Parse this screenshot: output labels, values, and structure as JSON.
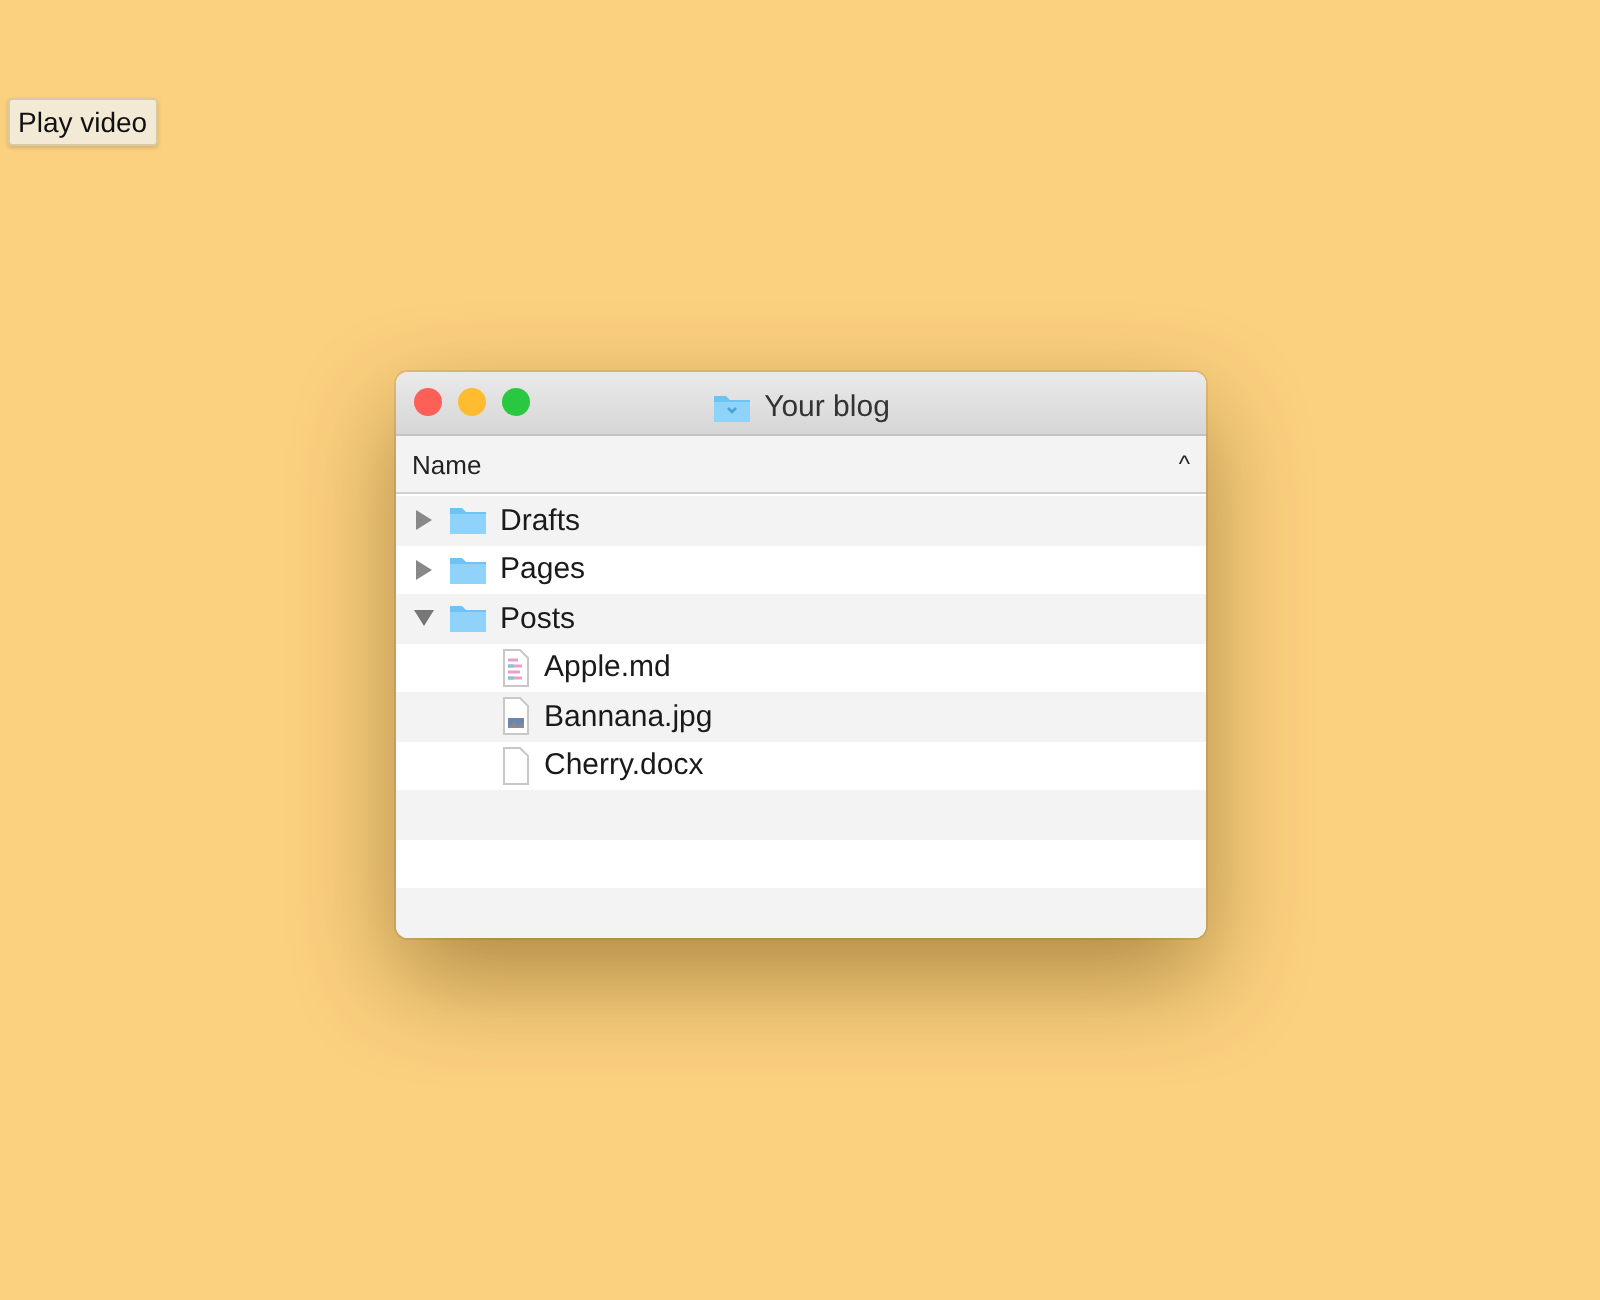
{
  "play_button": {
    "label": "Play video"
  },
  "window": {
    "title": "Your blog"
  },
  "header": {
    "column": "Name",
    "sort_indicator": "^"
  },
  "tree": [
    {
      "name": "Drafts",
      "kind": "folder",
      "expanded": false
    },
    {
      "name": "Pages",
      "kind": "folder",
      "expanded": false
    },
    {
      "name": "Posts",
      "kind": "folder",
      "expanded": true,
      "children": [
        {
          "name": "Apple.md",
          "kind": "text"
        },
        {
          "name": "Bannana.jpg",
          "kind": "image"
        },
        {
          "name": "Cherry.docx",
          "kind": "blank"
        }
      ]
    }
  ]
}
